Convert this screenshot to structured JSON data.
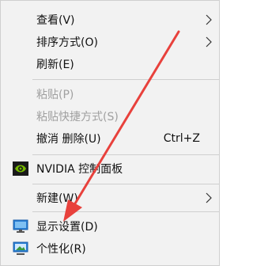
{
  "menu": {
    "items": [
      {
        "label": "查看(V)",
        "submenu": true,
        "enabled": true
      },
      {
        "label": "排序方式(O)",
        "submenu": true,
        "enabled": true
      },
      {
        "label": "刷新(E)",
        "enabled": true
      },
      {
        "label": "粘贴(P)",
        "enabled": false
      },
      {
        "label": "粘贴快捷方式(S)",
        "enabled": false
      },
      {
        "label": "撤消 删除(U)",
        "shortcut": "Ctrl+Z",
        "enabled": true
      },
      {
        "label": "NVIDIA 控制面板",
        "icon": "nvidia-icon",
        "enabled": true
      },
      {
        "label": "新建(W)",
        "submenu": true,
        "enabled": true
      },
      {
        "label": "显示设置(D)",
        "icon": "display-settings-icon",
        "enabled": true
      },
      {
        "label": "个性化(R)",
        "icon": "personalize-icon",
        "enabled": true
      }
    ]
  },
  "overlay": {
    "annotation": "red-arrow-pointing-to-display-settings",
    "color": "#e8413c"
  },
  "colors": {
    "menu_bg": "#f2f2f2",
    "text": "#111111",
    "disabled_text": "#a0a0a0",
    "separator": "#cfcfcf",
    "nvidia_green": "#76b900",
    "monitor_blue": "#2a7fd4"
  }
}
